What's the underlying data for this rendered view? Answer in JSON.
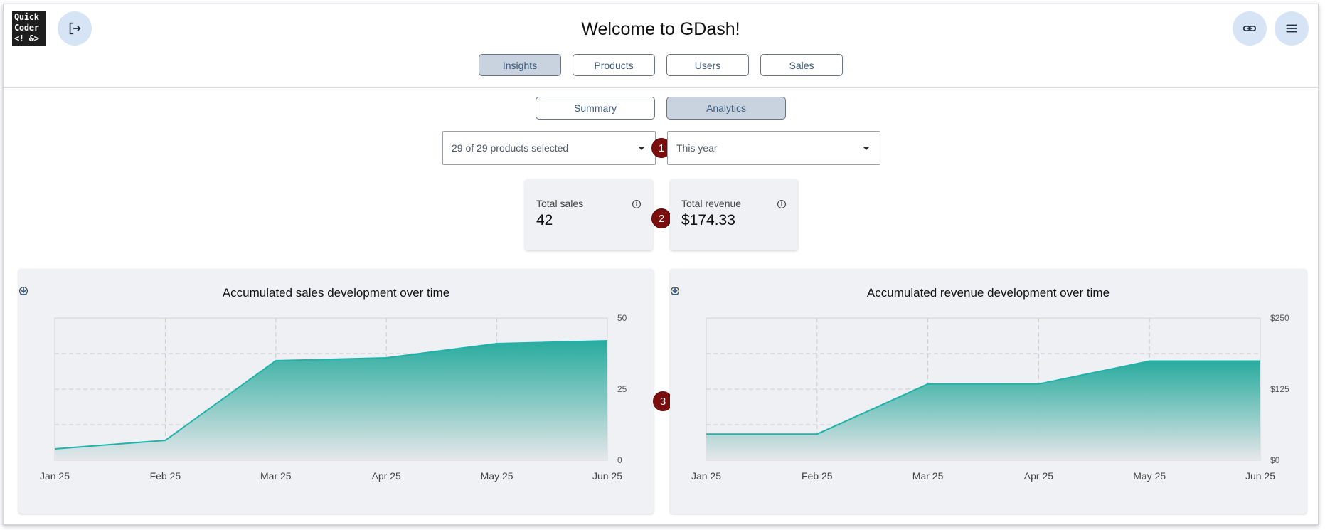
{
  "header": {
    "logo_text": "Quick\nCoder\n<! &>",
    "title": "Welcome to GDash!",
    "icons": {
      "logout": "logout-icon",
      "link": "link-icon",
      "menu": "menu-icon"
    }
  },
  "tabs": [
    {
      "label": "Insights",
      "active": true
    },
    {
      "label": "Products",
      "active": false
    },
    {
      "label": "Users",
      "active": false
    },
    {
      "label": "Sales",
      "active": false
    }
  ],
  "subtabs": [
    {
      "label": "Summary",
      "active": false
    },
    {
      "label": "Analytics",
      "active": true
    }
  ],
  "filters": {
    "products": "29 of 29 products selected",
    "period": "This year"
  },
  "markers": [
    "1",
    "2",
    "3"
  ],
  "kpis": [
    {
      "label": "Total sales",
      "value": "42"
    },
    {
      "label": "Total revenue",
      "value": "$174.33"
    }
  ],
  "colors": {
    "accent": "#20b2aa",
    "marker": "#7a0d0d",
    "tab_active": "#c8d3df"
  },
  "chart_data": [
    {
      "type": "area",
      "title": "Accumulated sales development over time",
      "x": [
        "Jan 25",
        "Feb 25",
        "Mar 25",
        "Apr 25",
        "May 25",
        "Jun 25"
      ],
      "values": [
        4,
        7,
        35,
        36,
        41,
        42
      ],
      "yticks": [
        "0",
        "25",
        "50"
      ],
      "ylim": [
        0,
        50
      ],
      "grid": true
    },
    {
      "type": "area",
      "title": "Accumulated revenue development over time",
      "x": [
        "Jan 25",
        "Feb 25",
        "Mar 25",
        "Apr 25",
        "May 25",
        "Jun 25"
      ],
      "values": [
        46,
        46,
        134,
        134,
        174.33,
        174.33
      ],
      "yticks": [
        "$0",
        "$125",
        "$250"
      ],
      "ylim": [
        0,
        250
      ],
      "grid": true
    }
  ]
}
